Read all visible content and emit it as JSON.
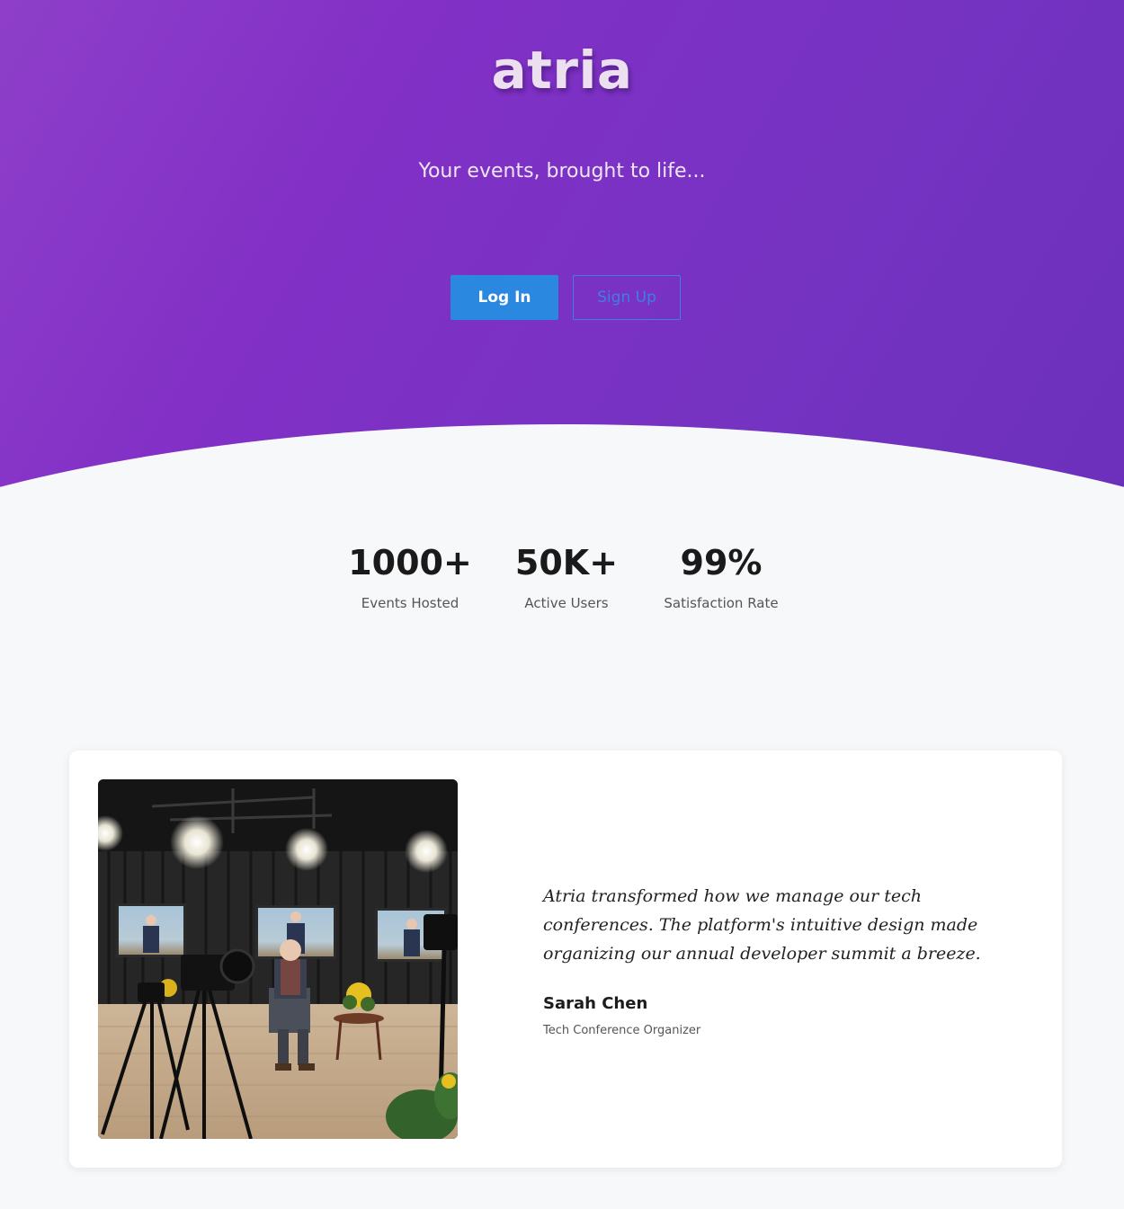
{
  "brand": {
    "name": "atria",
    "tagline": "Your events, brought to life..."
  },
  "auth": {
    "login_label": "Log In",
    "signup_label": "Sign Up"
  },
  "stats": [
    {
      "value": "1000+",
      "label": "Events Hosted"
    },
    {
      "value": "50K+",
      "label": "Active Users"
    },
    {
      "value": "99%",
      "label": "Satisfaction Rate"
    }
  ],
  "testimonial": {
    "quote": "Atria transformed how we manage our tech conferences. The platform's intuitive design made organizing our annual developer summit a breeze.",
    "author": "Sarah Chen",
    "role": "Tech Conference Organizer"
  },
  "colors": {
    "hero": "#8230c6",
    "primary": "#2a88e0",
    "background": "#f7f8fa"
  }
}
